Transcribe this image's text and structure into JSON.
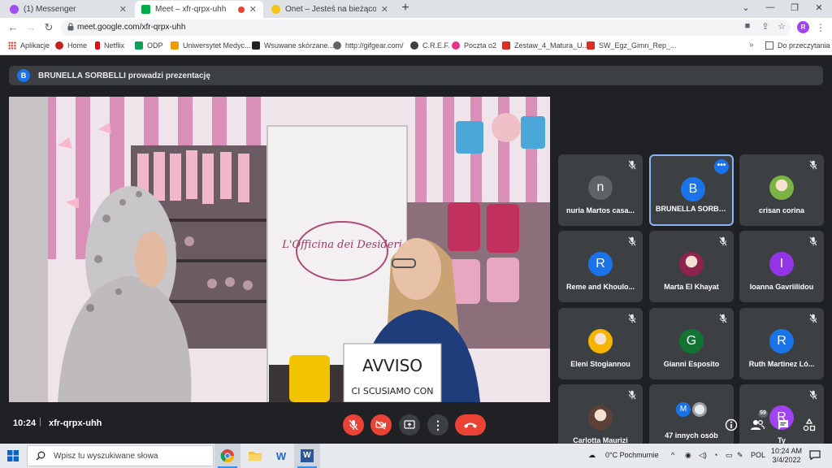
{
  "browser": {
    "tabs": [
      {
        "title": "(1) Messenger",
        "color": "#a050f0"
      },
      {
        "title": "Meet – xfr-qrpx-uhh",
        "color": "#00ac47"
      },
      {
        "title": "Onet – Jesteś na bieżąco",
        "color": "#f5c518"
      }
    ],
    "url": "meet.google.com/xfr-qrpx-uhh",
    "profile_initial": "R",
    "bookmarks": [
      {
        "label": "Aplikacje",
        "color": "#e94235"
      },
      {
        "label": "Home",
        "color": "#c5221f"
      },
      {
        "label": "Netflix",
        "color": "#e50914"
      },
      {
        "label": "ODP",
        "color": "#0f9d58"
      },
      {
        "label": "Uniwersytet Medyc...",
        "color": "#f29900"
      },
      {
        "label": "Wsuwane skórzane...",
        "color": "#202124"
      },
      {
        "label": "http://gifgear.com/",
        "color": "#5f6368"
      },
      {
        "label": "C.R.E.F.",
        "color": "#3c4043"
      },
      {
        "label": "Poczta o2",
        "color": "#e8338c"
      },
      {
        "label": "Zestaw_4_Matura_U...",
        "color": "#d93025"
      },
      {
        "label": "SW_Egz_Gimn_Rep_...",
        "color": "#d93025"
      }
    ],
    "reading_list": "Do przeczytania"
  },
  "meet": {
    "presenter_initial": "B",
    "presenter_text": "BRUNELLA SORBELLI prowadzi prezentację",
    "participants": [
      {
        "name": "nuria Martos casa...",
        "initial": "n",
        "color": "#5f6368",
        "muted": true
      },
      {
        "name": "BRUNELLA SORBE...",
        "initial": "B",
        "color": "#1a73e8",
        "muted": false,
        "selected": true
      },
      {
        "name": "crisan corina",
        "initial": "",
        "color": "#7cb342",
        "muted": true
      },
      {
        "name": "Reme and Khoulo...",
        "initial": "R",
        "color": "#1a73e8",
        "muted": true
      },
      {
        "name": "Marta El Khayat",
        "initial": "",
        "color": "#8e244d",
        "muted": true
      },
      {
        "name": "Ioanna Gavriilidou",
        "initial": "I",
        "color": "#9334e6",
        "muted": true
      },
      {
        "name": "Eleni Stogiannou",
        "initial": "",
        "color": "#f4b400",
        "muted": true
      },
      {
        "name": "Gianni Esposito",
        "initial": "G",
        "color": "#137333",
        "muted": true
      },
      {
        "name": "Ruth Martinez Ló...",
        "initial": "R",
        "color": "#1a73e8",
        "muted": true
      },
      {
        "name": "Carlotta Maurizi",
        "initial": "",
        "color": "#5d4037",
        "muted": true
      },
      {
        "name": "47 innych osób",
        "initial": "M",
        "color": "#1a73e8",
        "muted": false
      },
      {
        "name": "Ty",
        "initial": "R",
        "color": "#a142f4",
        "muted": true
      }
    ],
    "time": "10:24",
    "meeting_code": "xfr-qrpx-uhh",
    "participant_count": "59",
    "video_sign_text": "AVVISO",
    "video_sign_sub": "CI SCUSIAMO CON",
    "video_shop_text": "L'Officina dei Desideri"
  },
  "taskbar": {
    "search_placeholder": "Wpisz tu wyszukiwane słowa",
    "weather": "0°C Pochmurnie",
    "language": "POL",
    "time": "10:24 AM",
    "date": "3/4/2022"
  }
}
